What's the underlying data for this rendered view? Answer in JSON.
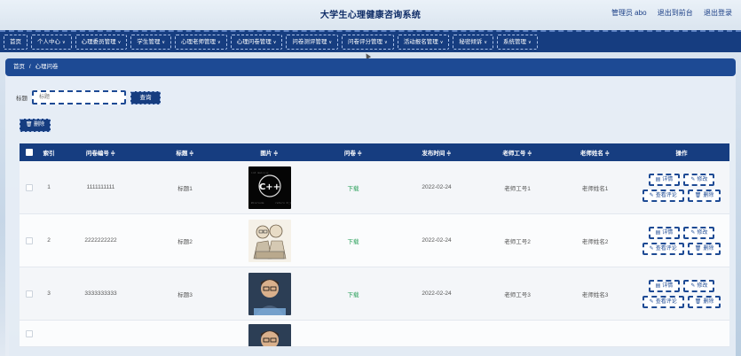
{
  "header": {
    "title": "大学生心理健康咨询系统",
    "user_label": "管理员 abo",
    "back_label": "退出到前台",
    "logout_label": "退出登录"
  },
  "nav": {
    "items": [
      {
        "label": "首页",
        "has_menu": false
      },
      {
        "label": "个人中心",
        "has_menu": true
      },
      {
        "label": "心理委员管理",
        "has_menu": true
      },
      {
        "label": "学生管理",
        "has_menu": true
      },
      {
        "label": "心理老师管理",
        "has_menu": true
      },
      {
        "label": "心理问卷管理",
        "has_menu": true
      },
      {
        "label": "问卷测评管理",
        "has_menu": true
      },
      {
        "label": "问卷评分管理",
        "has_menu": true
      },
      {
        "label": "活动报名管理",
        "has_menu": true
      },
      {
        "label": "秘密倾诉",
        "has_menu": true
      },
      {
        "label": "系统管理",
        "has_menu": true
      }
    ]
  },
  "breadcrumb": {
    "home": "首页",
    "sep": "/",
    "current": "心理问卷"
  },
  "search": {
    "label": "标题",
    "placeholder": "标题",
    "button": "查询"
  },
  "toolbar": {
    "delete_label": "删除",
    "delete_icon": "trash-icon"
  },
  "table": {
    "headers": {
      "index": "索引",
      "qno": "问卷编号 ≑",
      "title": "标题 ≑",
      "pic": "图片 ≑",
      "questionnaire": "问卷 ≑",
      "date": "发布时间 ≑",
      "teacher_no": "老师工号 ≑",
      "teacher_name": "老师姓名 ≑",
      "ops": "操作"
    },
    "rows": [
      {
        "index": "1",
        "qno": "1111111111",
        "title": "标题1",
        "file": "下载",
        "date": "2022-02-24",
        "teacher_no": "老师工号1",
        "teacher_name": "老师姓名1",
        "pic": "cpp-code"
      },
      {
        "index": "2",
        "qno": "2222222222",
        "title": "标题2",
        "file": "下载",
        "date": "2022-02-24",
        "teacher_no": "老师工号2",
        "teacher_name": "老师姓名2",
        "pic": "sketch-people"
      },
      {
        "index": "3",
        "qno": "3333333333",
        "title": "标题3",
        "file": "下载",
        "date": "2022-02-24",
        "teacher_no": "老师工号3",
        "teacher_name": "老师姓名3",
        "pic": "kid-computer"
      }
    ],
    "row_actions": {
      "detail": "详情",
      "edit": "修改",
      "comments": "查看评论",
      "delete": "删除"
    }
  },
  "colors": {
    "primary": "#163d80",
    "header_title": "#0d2b66",
    "download": "#2aa05a"
  }
}
